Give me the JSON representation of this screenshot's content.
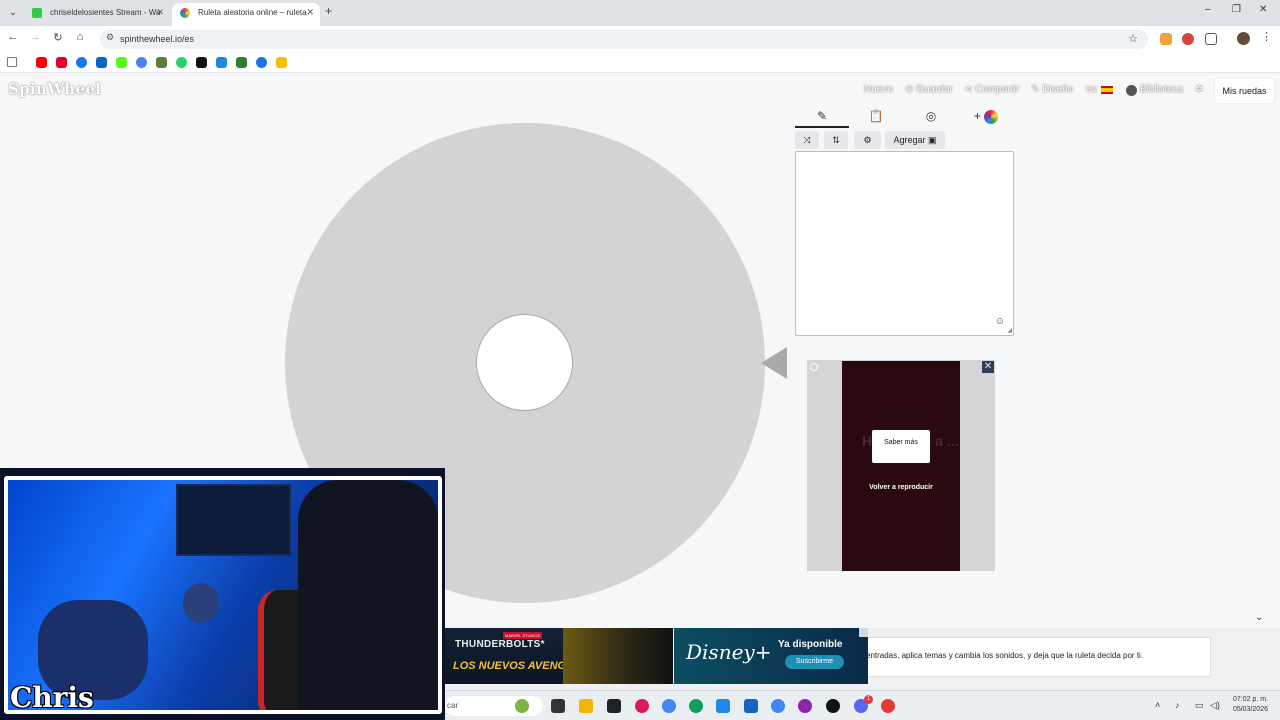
{
  "browser": {
    "tabs": [
      {
        "title": "chriseldelosientes Stream - Wa",
        "close": "✕",
        "favicon_color": "#2ecc40"
      },
      {
        "title": "Ruleta aleatoria online – ruleta",
        "close": "✕",
        "favicon_color": "#e53935"
      }
    ],
    "new_tab": "+",
    "window_controls": [
      "–",
      "❐",
      "✕"
    ],
    "url": "spinthewheel.io/es",
    "bookmark_colors": [
      "#ff0000",
      "#e4002b",
      "#1877f2",
      "#0a66c2",
      "#53fc18",
      "#4285f4",
      "#5b7c3a",
      "#25d366",
      "#111111",
      "#1e88e5",
      "#2e7d32",
      "#1a73e8",
      "#1877f2",
      "#fbbc04"
    ],
    "extension_colors": [
      "#f1a33a",
      "#d7443b",
      "#555555"
    ]
  },
  "site": {
    "logo": "SpinWheel",
    "nav": {
      "nuevo": "Nuevo",
      "guardar": "Guardar",
      "compartir": "Compartir",
      "diseno": "Diseño",
      "lang": "es",
      "biblioteca": "Biblioteca",
      "mis_ruedas": "Mis ruedas"
    },
    "editor": {
      "tab_icons": [
        "pencil-icon",
        "clipboard-icon",
        "eye-off-icon",
        "color-wheel-icon"
      ],
      "tab_plus": "+",
      "agregar": "Agregar",
      "emoji": "☺"
    },
    "ad": {
      "ghost_text": "H...k, have a ...",
      "saber": "Saber más",
      "volver": "Volver a reproducir",
      "close": "✕"
    },
    "bottom": {
      "description": "entradas, aplica temas y cambia los sonidos, y deja que la ruleta decida por ti."
    },
    "banner": {
      "marvel": "MARVEL STUDIOS",
      "title": "THUNDERBOLTS*",
      "subtitle": "LOS NUEVOS AVENGERS",
      "disney": "Disney+",
      "available": "Ya disponible",
      "subscribe": "Suscribirme"
    }
  },
  "webcam": {
    "name": "Chris"
  },
  "taskbar": {
    "search_fragment": "car",
    "time": "07:02 p. m.",
    "date": "05/03/2026",
    "badge_count": "1"
  }
}
